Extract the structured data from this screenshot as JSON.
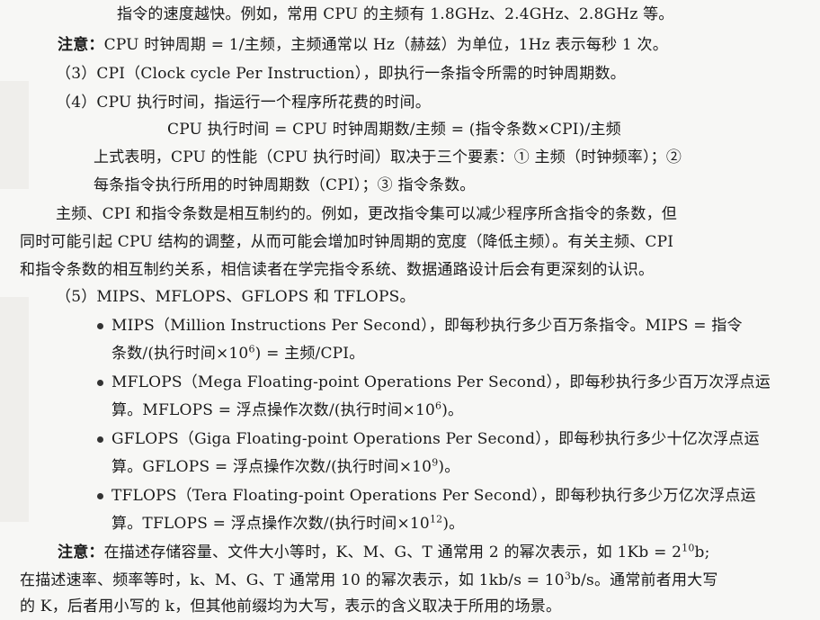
{
  "lines": {
    "l1": "指令的速度越快。例如，常用 CPU 的主频有 1.8GHz、2.4GHz、2.8GHz 等。",
    "note1_label": "注意：",
    "note1_text": "CPU 时钟周期 = 1/主频，主频通常以 Hz（赫兹）为单位，1Hz 表示每秒 1 次。",
    "l3": "（3）CPI（Clock cycle Per Instruction），即执行一条指令所需的时钟周期数。",
    "l4": "（4）CPU 执行时间，指运行一个程序所花费的时间。",
    "formula": "CPU 执行时间 = CPU 时钟周期数/主频 = (指令条数×CPI)/主频",
    "l6": "上式表明，CPU 的性能（CPU 执行时间）取决于三个要素：① 主频（时钟频率）；②",
    "l7": "每条指令执行所用的时钟周期数（CPI）；③ 指令条数。",
    "p1": "主频、CPI 和指令条数是相互制约的。例如，更改指令集可以减少程序所含指令的条数，但",
    "p2": "同时可能引起 CPU 结构的调整，从而可能会增加时钟周期的宽度（降低主频）。有关主频、CPI",
    "p3": "和指令条数的相互制约关系，相信读者在学完指令系统、数据通路设计后会有更深刻的认识。",
    "l5": "（5）MIPS、MFLOPS、GFLOPS 和 TFLOPS。",
    "mips1": "MIPS（Million Instructions Per Second），即每秒执行多少百万条指令。MIPS = 指令",
    "mips2a": "条数/(执行时间×10",
    "mips2sup": "6",
    "mips2b": ") = 主频/CPI。",
    "mf1": "MFLOPS（Mega Floating-point Operations Per Second），即每秒执行多少百万次浮点运",
    "mf2a": "算。MFLOPS = 浮点操作次数/(执行时间×10",
    "mf2sup": "6",
    "mf2b": ")。",
    "gf1": "GFLOPS（Giga Floating-point Operations Per Second），即每秒执行多少十亿次浮点运",
    "gf2a": "算。GFLOPS = 浮点操作次数/(执行时间×10",
    "gf2sup": "9",
    "gf2b": ")。",
    "tf1": "TFLOPS（Tera Floating-point Operations Per Second），即每秒执行多少万亿次浮点运",
    "tf2a": "算。TFLOPS = 浮点操作次数/(执行时间×10",
    "tf2sup": "12",
    "tf2b": ")。",
    "note2_label": "注意：",
    "note2_text_a": "在描述存储容量、文件大小等时，K、M、G、T 通常用 2 的幂次表示，如 1Kb = 2",
    "note2_sup1": "10",
    "note2_text_b": "b;",
    "n2_l2a": "在描述速率、频率等时，k、M、G、T 通常用 10 的幂次表示，如 1kb/s = 10",
    "n2_sup2": "3",
    "n2_l2b": "b/s。通常前者用大写",
    "n2_l3": "的 K，后者用小写的 k，但其他前缀均为大写，表示的含义取决于所用的场景。"
  }
}
